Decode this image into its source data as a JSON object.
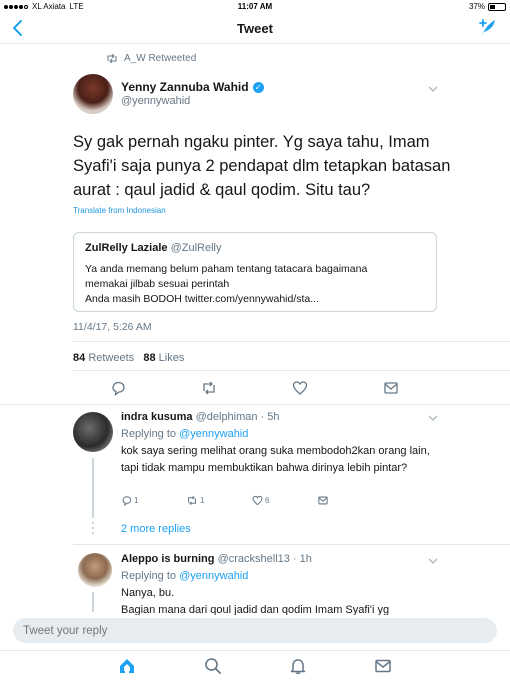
{
  "status": {
    "carrier": "XL Axiata",
    "network": "LTE",
    "time": "11:07 AM",
    "battery": "37%",
    "battery_level": 0.37
  },
  "nav": {
    "title": "Tweet"
  },
  "tweet": {
    "retweeted_by": "A_W Retweeted",
    "author_name": "Yenny Zannuba Wahid",
    "author_handle": "@yennywahid",
    "text": "Sy gak pernah ngaku pinter. Yg saya tahu, Imam Syafi'i saja punya 2 pendapat dlm tetapkan batasan aurat : qaul jadid & qaul qodim. Situ tau?",
    "translate": "Translate from Indonesian",
    "quote": {
      "name": "ZulRelly Laziale",
      "handle": "@ZulRelly",
      "line1": "Ya anda memang belum paham tentang tatacara bagaimana",
      "line2": "memakai jilbab sesuai perintah",
      "line3": "Anda masih BODOH twitter.com/yennywahid/sta..."
    },
    "timestamp": "11/4/17, 5:26 AM",
    "retweets_count": "84",
    "retweets_label": "Retweets",
    "likes_count": "88",
    "likes_label": "Likes"
  },
  "replies": [
    {
      "name": "indra kusuma",
      "meta": "@delphiman · 5h",
      "replying_prefix": "Replying to",
      "replying_to": "@yennywahid",
      "text": "kok saya sering melihat orang suka membodoh2kan orang lain, tapi tidak mampu membuktikan bahwa dirinya lebih pintar?",
      "reply_count": "1",
      "retweet_count": "1",
      "like_count": "6",
      "more_replies": "2 more replies"
    },
    {
      "name": "Aleppo is burning",
      "meta": "@crackshell13 · 1h",
      "replying_prefix": "Replying to",
      "replying_to": "@yennywahid",
      "text_line1": "Nanya, bu.",
      "text_line2": "Bagian mana dari qoul jadid dan qodim Imam Syafi'i yg"
    }
  ],
  "reply_box": {
    "placeholder": "Tweet your reply"
  },
  "tabs": [
    "home-icon",
    "search-icon",
    "notifications-icon",
    "messages-icon"
  ],
  "colors": {
    "accent": "#1da1f2",
    "secondary_text": "#657786",
    "divider": "#e1e8ed"
  }
}
